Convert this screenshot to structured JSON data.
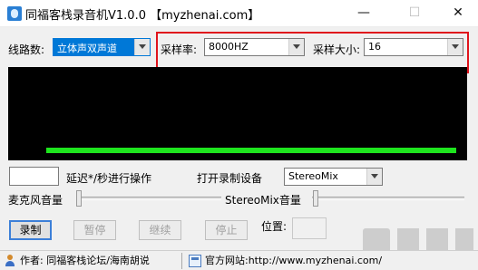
{
  "window": {
    "title": "同福客栈录音机V1.0.0 【myzhenai.com】",
    "min_glyph": "—",
    "max_glyph": "☐",
    "close_glyph": "✕"
  },
  "line_input": {
    "label": "线路数:",
    "value": "立体声双声道"
  },
  "sample_rate": {
    "label": "采样率:",
    "value": "8000HZ"
  },
  "sample_size": {
    "label": "采样大小:",
    "value": "16"
  },
  "delay": {
    "value": "",
    "label": "延迟*/秒进行操作"
  },
  "device": {
    "label": "打开录制设备",
    "value": "StereoMix"
  },
  "mic_volume": {
    "label": "麦克风音量"
  },
  "stereomix_volume": {
    "label": "StereoMix音量"
  },
  "buttons": {
    "record": "录制",
    "pause": "暂停",
    "resume": "继续",
    "stop": "停止"
  },
  "position": {
    "label": "位置:",
    "value": ""
  },
  "statusbar": {
    "author": "作者: 同福客栈论坛/海南胡说",
    "website": "官方网站:http://www.myzhenai.com/"
  },
  "colors": {
    "level_meter": "#1ee51e",
    "highlight_box": "#e0141c",
    "selection": "#0078d7"
  }
}
